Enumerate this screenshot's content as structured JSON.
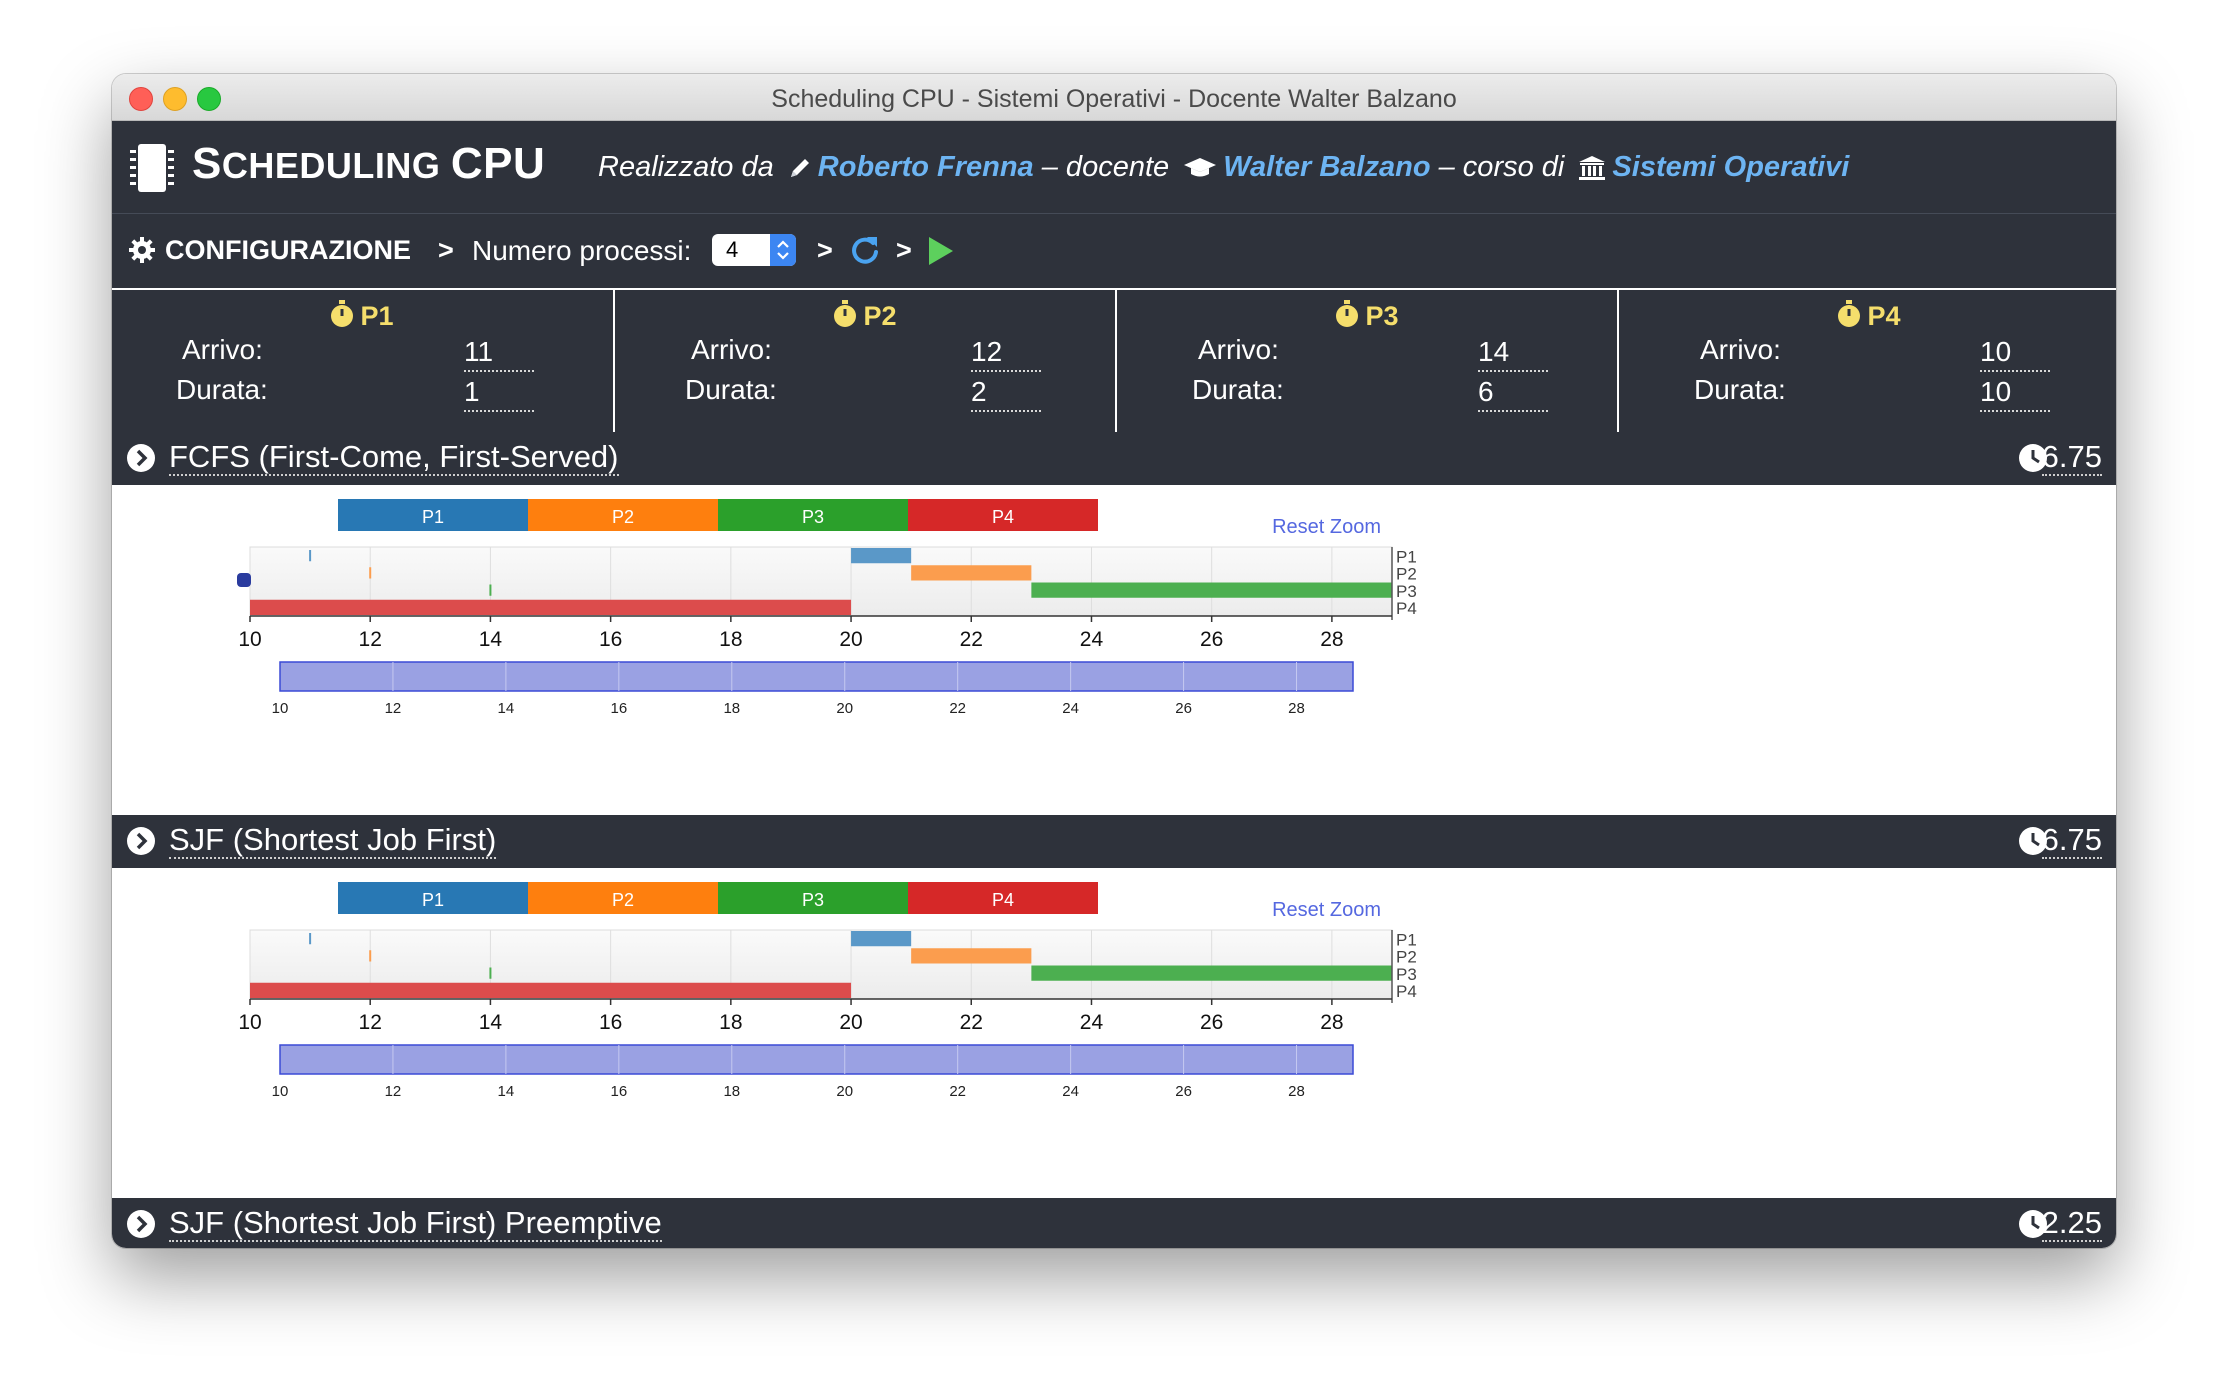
{
  "window": {
    "title": "Scheduling CPU - Sistemi Operativi - Docente Walter Balzano"
  },
  "header": {
    "title_first_big": "S",
    "title_first_small": "CHEDULING ",
    "title_rest": "CPU",
    "made_by_label": "Realizzato da",
    "author": "Roberto Frenna",
    "teacher_label": "– docente",
    "teacher": "Walter Balzano",
    "course_label": "– corso di",
    "course": "Sistemi Operativi"
  },
  "config": {
    "label": "CONFIGURAZIONE",
    "separator": ">",
    "num_processes_label": "Numero processi:",
    "num_processes_value": "4"
  },
  "processes": [
    {
      "name": "P1",
      "arrival_label": "Arrivo:",
      "arrival": "11",
      "duration_label": "Durata:",
      "duration": "1"
    },
    {
      "name": "P2",
      "arrival_label": "Arrivo:",
      "arrival": "12",
      "duration_label": "Durata:",
      "duration": "2"
    },
    {
      "name": "P3",
      "arrival_label": "Arrivo:",
      "arrival": "14",
      "duration_label": "Durata:",
      "duration": "6"
    },
    {
      "name": "P4",
      "arrival_label": "Arrivo:",
      "arrival": "10",
      "duration_label": "Durata:",
      "duration": "10"
    }
  ],
  "colors": {
    "P1": "#2878b4",
    "P2": "#fe7f0e",
    "P3": "#2ba02b",
    "P4": "#d62828",
    "P1_bar": "#5a98c8",
    "P2_bar": "#fb9d4e",
    "P3_bar": "#4caf50",
    "P4_bar": "#dc4c4c",
    "navigator": "#9aa1e3",
    "link": "#6db4f2",
    "play": "#5dd05d"
  },
  "algorithms": [
    {
      "name": "FCFS (First-Come, First-Served)",
      "avg_wait": "6.75"
    },
    {
      "name": "SJF (Shortest Job First)",
      "avg_wait": "6.75"
    },
    {
      "name": "SJF (Shortest Job First) Preemptive",
      "avg_wait": "2.25"
    }
  ],
  "chart_labels": {
    "reset_zoom": "Reset Zoom"
  },
  "chart_data": [
    {
      "type": "bar",
      "title": "",
      "legend": [
        "P1",
        "P2",
        "P3",
        "P4"
      ],
      "rows": [
        "P1",
        "P2",
        "P3",
        "P4"
      ],
      "xlim": [
        10,
        29
      ],
      "xticks": [
        10,
        12,
        14,
        16,
        18,
        20,
        22,
        24,
        26,
        28
      ],
      "arrivals": [
        {
          "row": "P1",
          "x": 11
        },
        {
          "row": "P2",
          "x": 12
        },
        {
          "row": "P3",
          "x": 14
        }
      ],
      "segments": [
        {
          "row": "P4",
          "start": 10,
          "end": 20
        },
        {
          "row": "P1",
          "start": 20,
          "end": 21
        },
        {
          "row": "P2",
          "start": 21,
          "end": 23
        },
        {
          "row": "P3",
          "start": 23,
          "end": 29
        }
      ],
      "navigator_ticks": [
        10,
        12,
        14,
        16,
        18,
        20,
        22,
        24,
        26,
        28
      ]
    },
    {
      "type": "bar",
      "title": "",
      "legend": [
        "P1",
        "P2",
        "P3",
        "P4"
      ],
      "rows": [
        "P1",
        "P2",
        "P3",
        "P4"
      ],
      "xlim": [
        10,
        29
      ],
      "xticks": [
        10,
        12,
        14,
        16,
        18,
        20,
        22,
        24,
        26,
        28
      ],
      "arrivals": [
        {
          "row": "P1",
          "x": 11
        },
        {
          "row": "P2",
          "x": 12
        },
        {
          "row": "P3",
          "x": 14
        }
      ],
      "segments": [
        {
          "row": "P4",
          "start": 10,
          "end": 20
        },
        {
          "row": "P1",
          "start": 20,
          "end": 21
        },
        {
          "row": "P2",
          "start": 21,
          "end": 23
        },
        {
          "row": "P3",
          "start": 23,
          "end": 29
        }
      ],
      "navigator_ticks": [
        10,
        12,
        14,
        16,
        18,
        20,
        22,
        24,
        26,
        28
      ]
    }
  ]
}
